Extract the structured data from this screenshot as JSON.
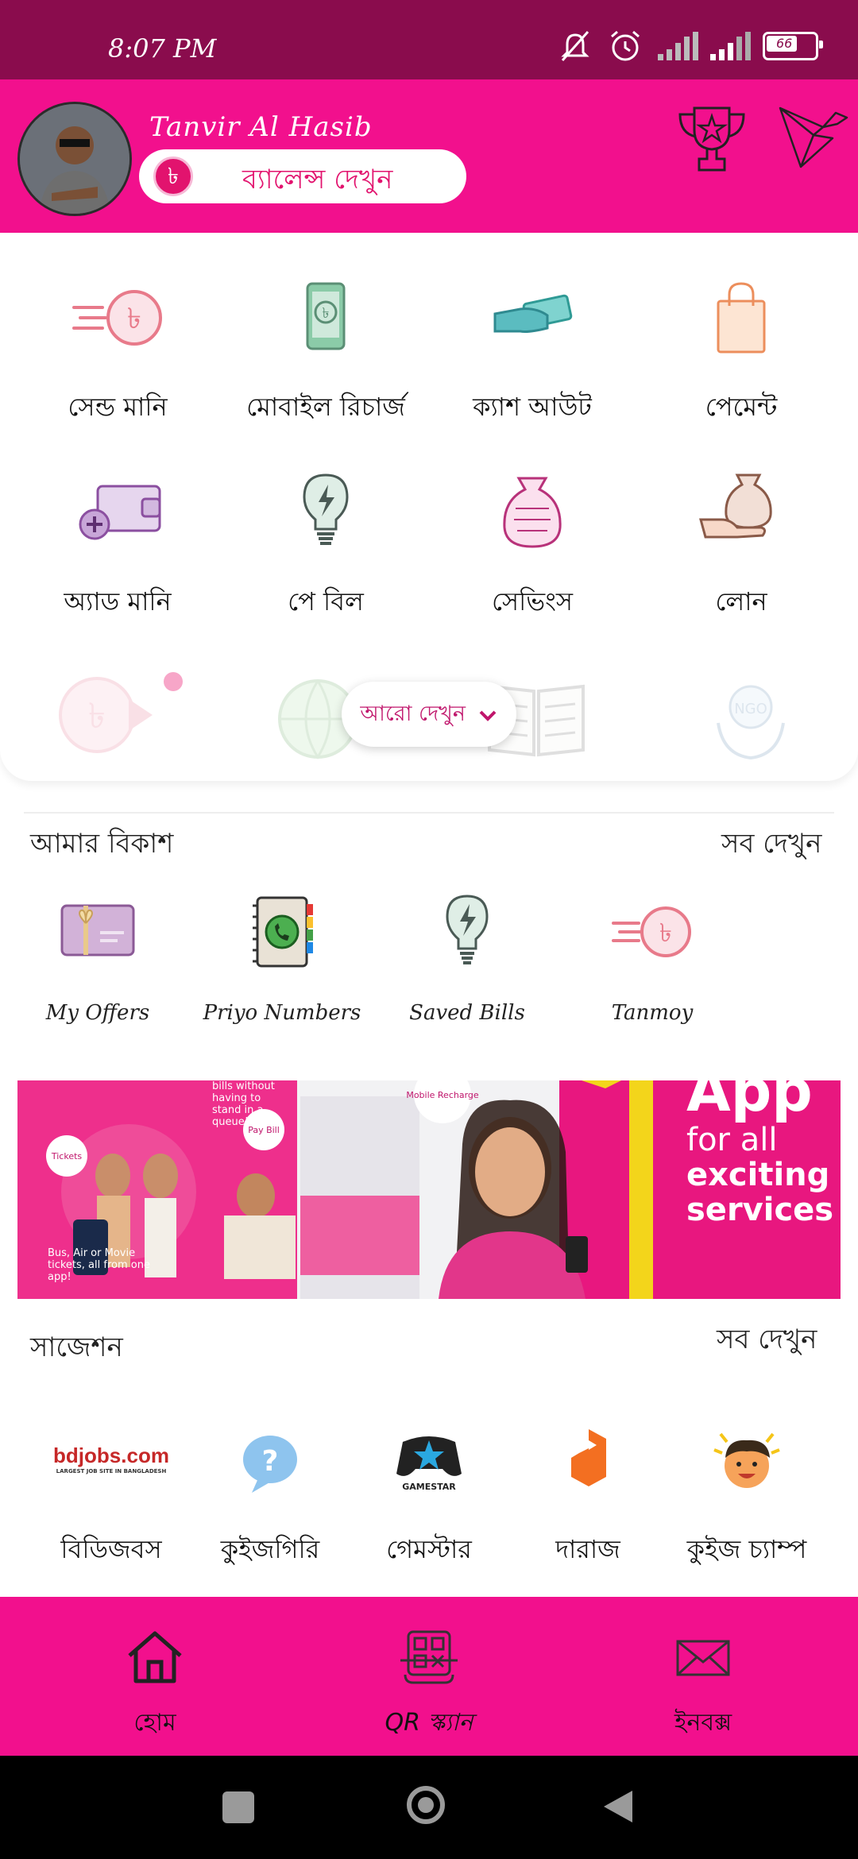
{
  "status_bar": {
    "time": "8:07 PM",
    "battery": "66"
  },
  "header": {
    "user_name": "Tanvir Al Hasib",
    "balance_label": "ব্যালেন্স দেখুন",
    "taka_symbol": "৳"
  },
  "services": {
    "row1": [
      {
        "label": "সেন্ড মানি",
        "icon": "send-money-icon"
      },
      {
        "label": "মোবাইল রিচার্জ",
        "icon": "mobile-recharge-icon"
      },
      {
        "label": "ক্যাশ আউট",
        "icon": "cash-out-icon"
      },
      {
        "label": "পেমেন্ট",
        "icon": "payment-bag-icon"
      }
    ],
    "row2": [
      {
        "label": "অ্যাড মানি",
        "icon": "add-money-wallet-icon"
      },
      {
        "label": "পে বিল",
        "icon": "pay-bill-bulb-icon"
      },
      {
        "label": "সেভিংস",
        "icon": "savings-bag-icon"
      },
      {
        "label": "লোন",
        "icon": "loan-hand-icon"
      }
    ],
    "more_label": "আরো দেখুন"
  },
  "my_bkash": {
    "title": "আমার বিকাশ",
    "see_all": "সব দেখুন",
    "items": [
      {
        "label": "My Offers",
        "icon": "gift-card-icon"
      },
      {
        "label": "Priyo Numbers",
        "icon": "phone-book-icon"
      },
      {
        "label": "Saved Bills",
        "icon": "bulb-icon"
      },
      {
        "label": "Tanmoy",
        "icon": "send-money-icon"
      }
    ]
  },
  "banner": {
    "headline_top": "App",
    "headline": [
      "for all",
      "exciting",
      "services"
    ],
    "bubble_queue": "bills without having to stand in a queue!",
    "bubble_tickets": "Tickets",
    "bubble_paybill": "Pay Bill",
    "bubble_bus": "Bus, Air or Movie tickets, all from one app!",
    "bubble_recharge": "Mobile Recharge"
  },
  "suggestions": {
    "title": "সাজেশন",
    "see_all": "সব দেখুন",
    "items": [
      {
        "label": "বিডিজবস",
        "logo_text": "bdjobs.com",
        "logo_sub": "LARGEST JOB SITE IN BANGLADESH"
      },
      {
        "label": "কুইজগিরি",
        "logo_text": "?"
      },
      {
        "label": "গেমস্টার",
        "logo_text": "GAMESTAR"
      },
      {
        "label": "দারাজ",
        "logo_text": ""
      },
      {
        "label": "কুইজ চ্যাম্প",
        "logo_text": ""
      }
    ]
  },
  "bottom_nav": {
    "items": [
      {
        "label": "হোম",
        "icon": "home-icon"
      },
      {
        "label": "QR স্ক্যান",
        "icon": "qr-scan-icon"
      },
      {
        "label": "ইনবক্স",
        "icon": "inbox-envelope-icon"
      }
    ]
  },
  "colors": {
    "status_bar": "#8a0c4d",
    "brand_pink": "#f2108d",
    "accent": "#e2136e"
  }
}
